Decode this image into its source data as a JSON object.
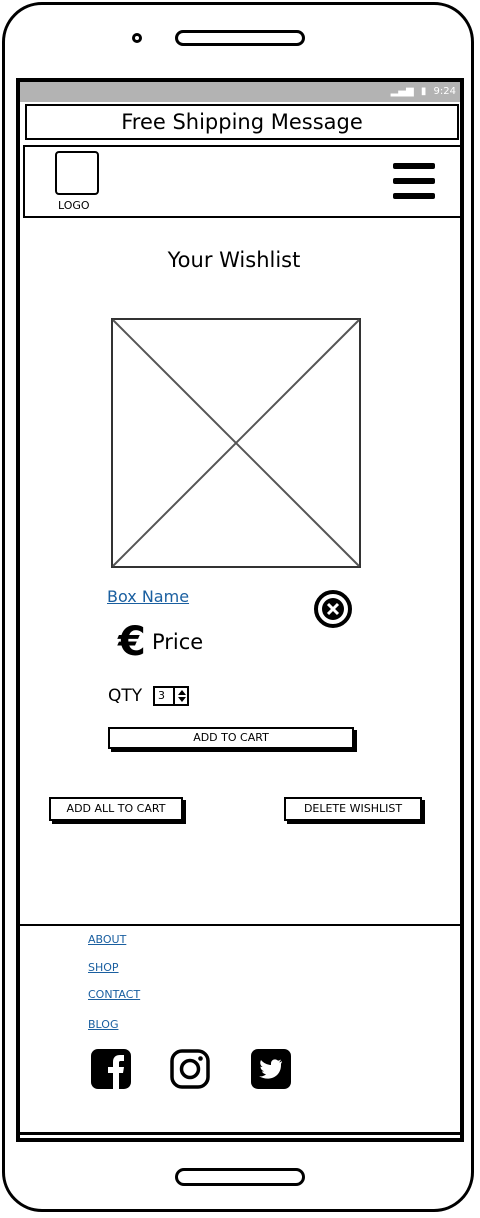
{
  "status": {
    "time": "9:24"
  },
  "banner": {
    "text": "Free Shipping Message"
  },
  "header": {
    "logo_label": "LOGO"
  },
  "page": {
    "title": "Your Wishlist"
  },
  "item": {
    "name": "Box Name",
    "currency_symbol": "€",
    "price_label": "Price",
    "qty_label": "QTY",
    "qty_value": "3",
    "add_to_cart": "ADD TO CART"
  },
  "actions": {
    "add_all": "ADD ALL TO CART",
    "delete_wishlist": "DELETE WISHLIST"
  },
  "footer": {
    "links": [
      "ABOUT",
      "SHOP",
      "CONTACT",
      "BLOG"
    ],
    "social_icons": [
      "facebook-icon",
      "instagram-icon",
      "twitter-icon"
    ]
  }
}
